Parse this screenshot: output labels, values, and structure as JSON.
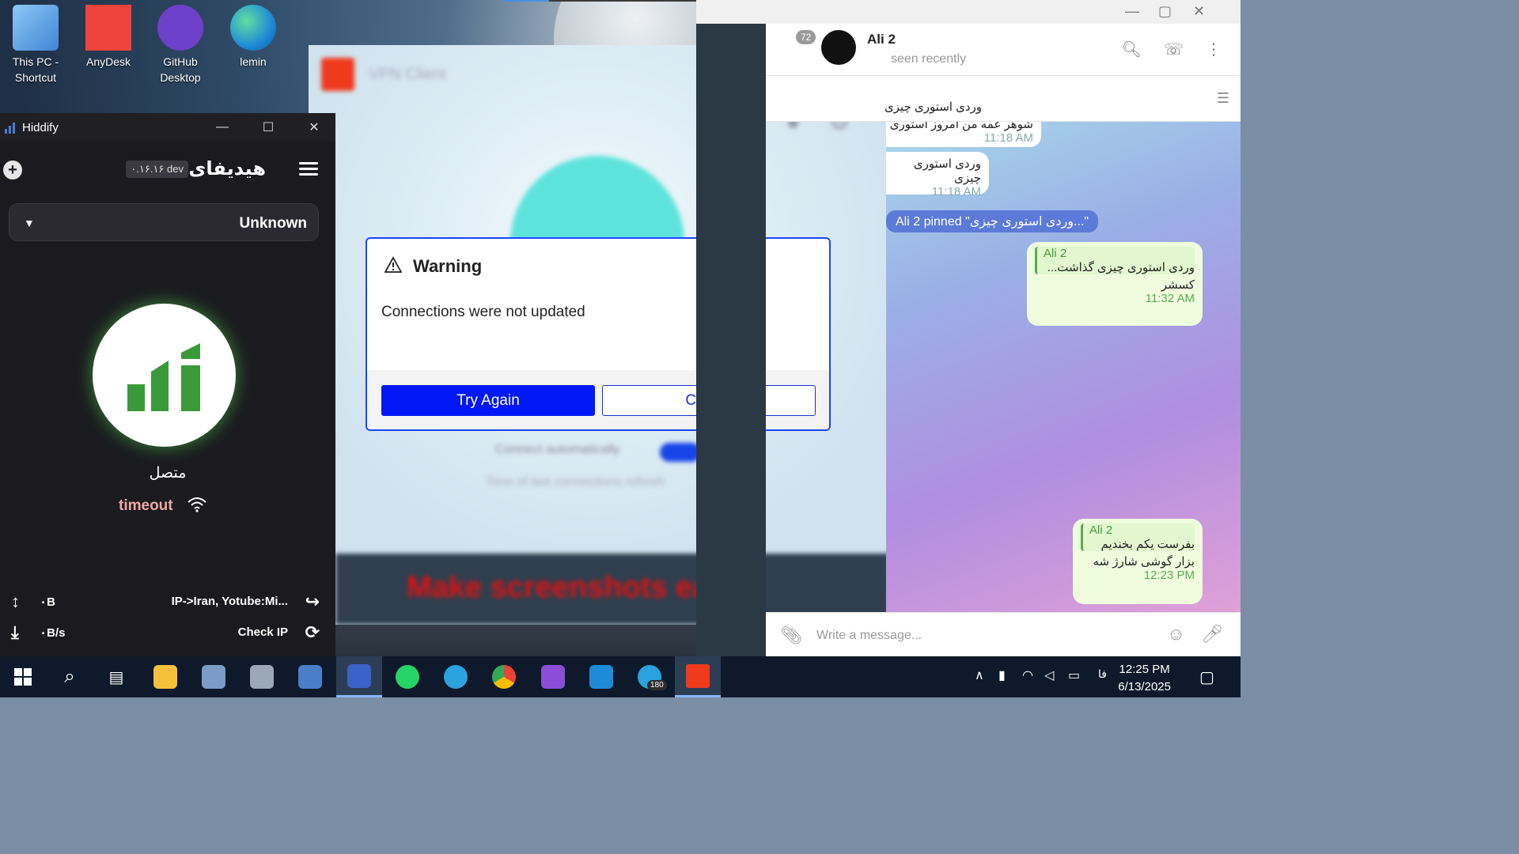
{
  "desktop": {
    "icons": [
      {
        "label": "This PC - Shortcut",
        "color": "#4a8fd8"
      },
      {
        "label": "AnyDesk",
        "color": "#ef443b"
      },
      {
        "label": "GitHub Desktop",
        "color": "#6e40c9"
      },
      {
        "label": "lemin",
        "color": "#1f8ad6"
      }
    ]
  },
  "hiddify": {
    "window_title": "Hiddify",
    "app_title": "هیدیفای",
    "version_badge": "۰.۱۶.۱۶ dev",
    "profile_select": "Unknown",
    "connection_status": "متصل",
    "ping_status": "timeout",
    "upload": "۰B",
    "download": "۰B/s",
    "route_info": "IP->Iran, Yotube:Mi...",
    "check_ip": "Check IP",
    "brand_color": "#3a9a3a"
  },
  "vpn_client": {
    "window_title": "VPN Client",
    "banner_text": "Make screenshots easy",
    "auto_connect_label": "Connect automatically",
    "last_refresh_label": "Time of last connections refresh",
    "accent": "#ef3a1c"
  },
  "dialog": {
    "title": "Warning",
    "message": "Connections were not updated",
    "try_again": "Try Again",
    "cancel": "Cancel",
    "primary_color": "#0018f5"
  },
  "telegram": {
    "unread_count": "72",
    "contact_name": "Ali 2",
    "status": "seen recently",
    "pinned_text": "وردی استوری چیزی",
    "messages": [
      {
        "text": "شوهر عمه من امروز استوری گذاشته ولی این هنوز از",
        "time": "11:18 AM"
      },
      {
        "text": "وردی استوری چیزی",
        "time": "11:18 AM"
      }
    ],
    "service_message": "Ali 2 pinned \"وردی استوری چیزی...\"",
    "out_msg_1": {
      "reply_name": "Ali 2",
      "reply_text": "وردی استوری چیزی گذاشت...",
      "text": "کسشر",
      "time": "11:32 AM"
    },
    "out_msg_2": {
      "reply_name": "Ali 2",
      "reply_text": "بفرست یکم بخندیم",
      "text": "بزار گوشی شارژ شه",
      "time": "12:23 PM"
    },
    "input_placeholder": "Write a message..."
  },
  "taskbar": {
    "telegram_badge": "180",
    "time": "12:25 PM",
    "date": "6/13/2025",
    "lang": "فا"
  }
}
